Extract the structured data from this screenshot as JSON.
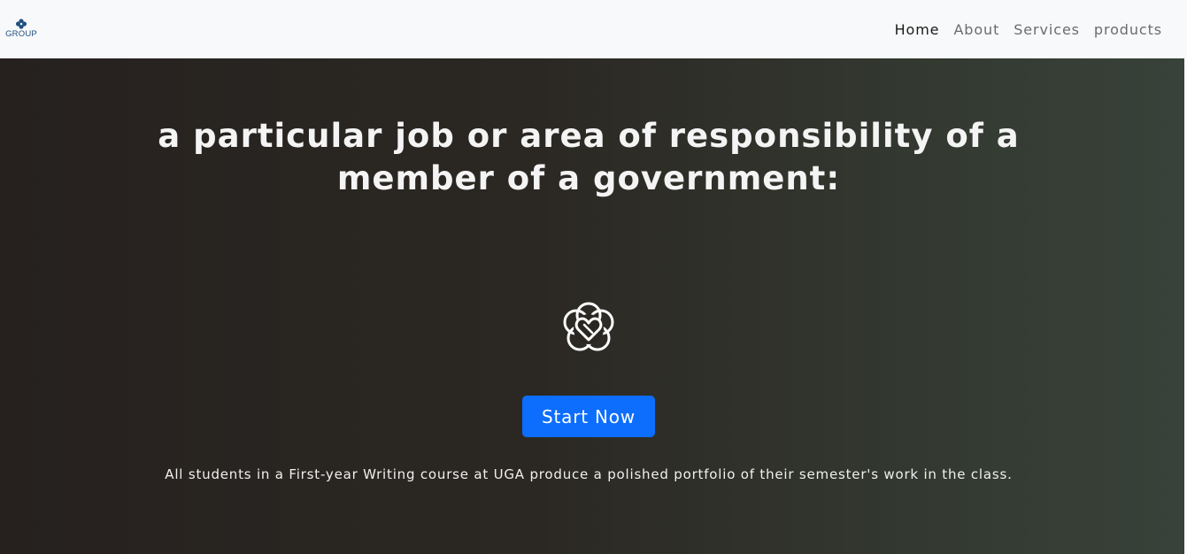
{
  "brand": {
    "text": "GROUP",
    "icon": "flower-logo-icon",
    "color": "#1f4f80"
  },
  "nav": {
    "items": [
      {
        "label": "Home",
        "active": true
      },
      {
        "label": "About",
        "active": false
      },
      {
        "label": "Services",
        "active": false
      },
      {
        "label": "products",
        "active": false
      }
    ]
  },
  "hero": {
    "title": "a particular job or area of responsibility of a member of a government:",
    "icon": "flower-heart-icon",
    "button_label": "Start Now",
    "caption": "All students in a First-year Writing course at UGA produce a polished portfolio of their semester's work in the class."
  },
  "colors": {
    "accent": "#0d6efd",
    "navbar_bg": "#f8f9fa",
    "hero_bg_start": "#26211f",
    "hero_bg_end": "#38423a"
  }
}
